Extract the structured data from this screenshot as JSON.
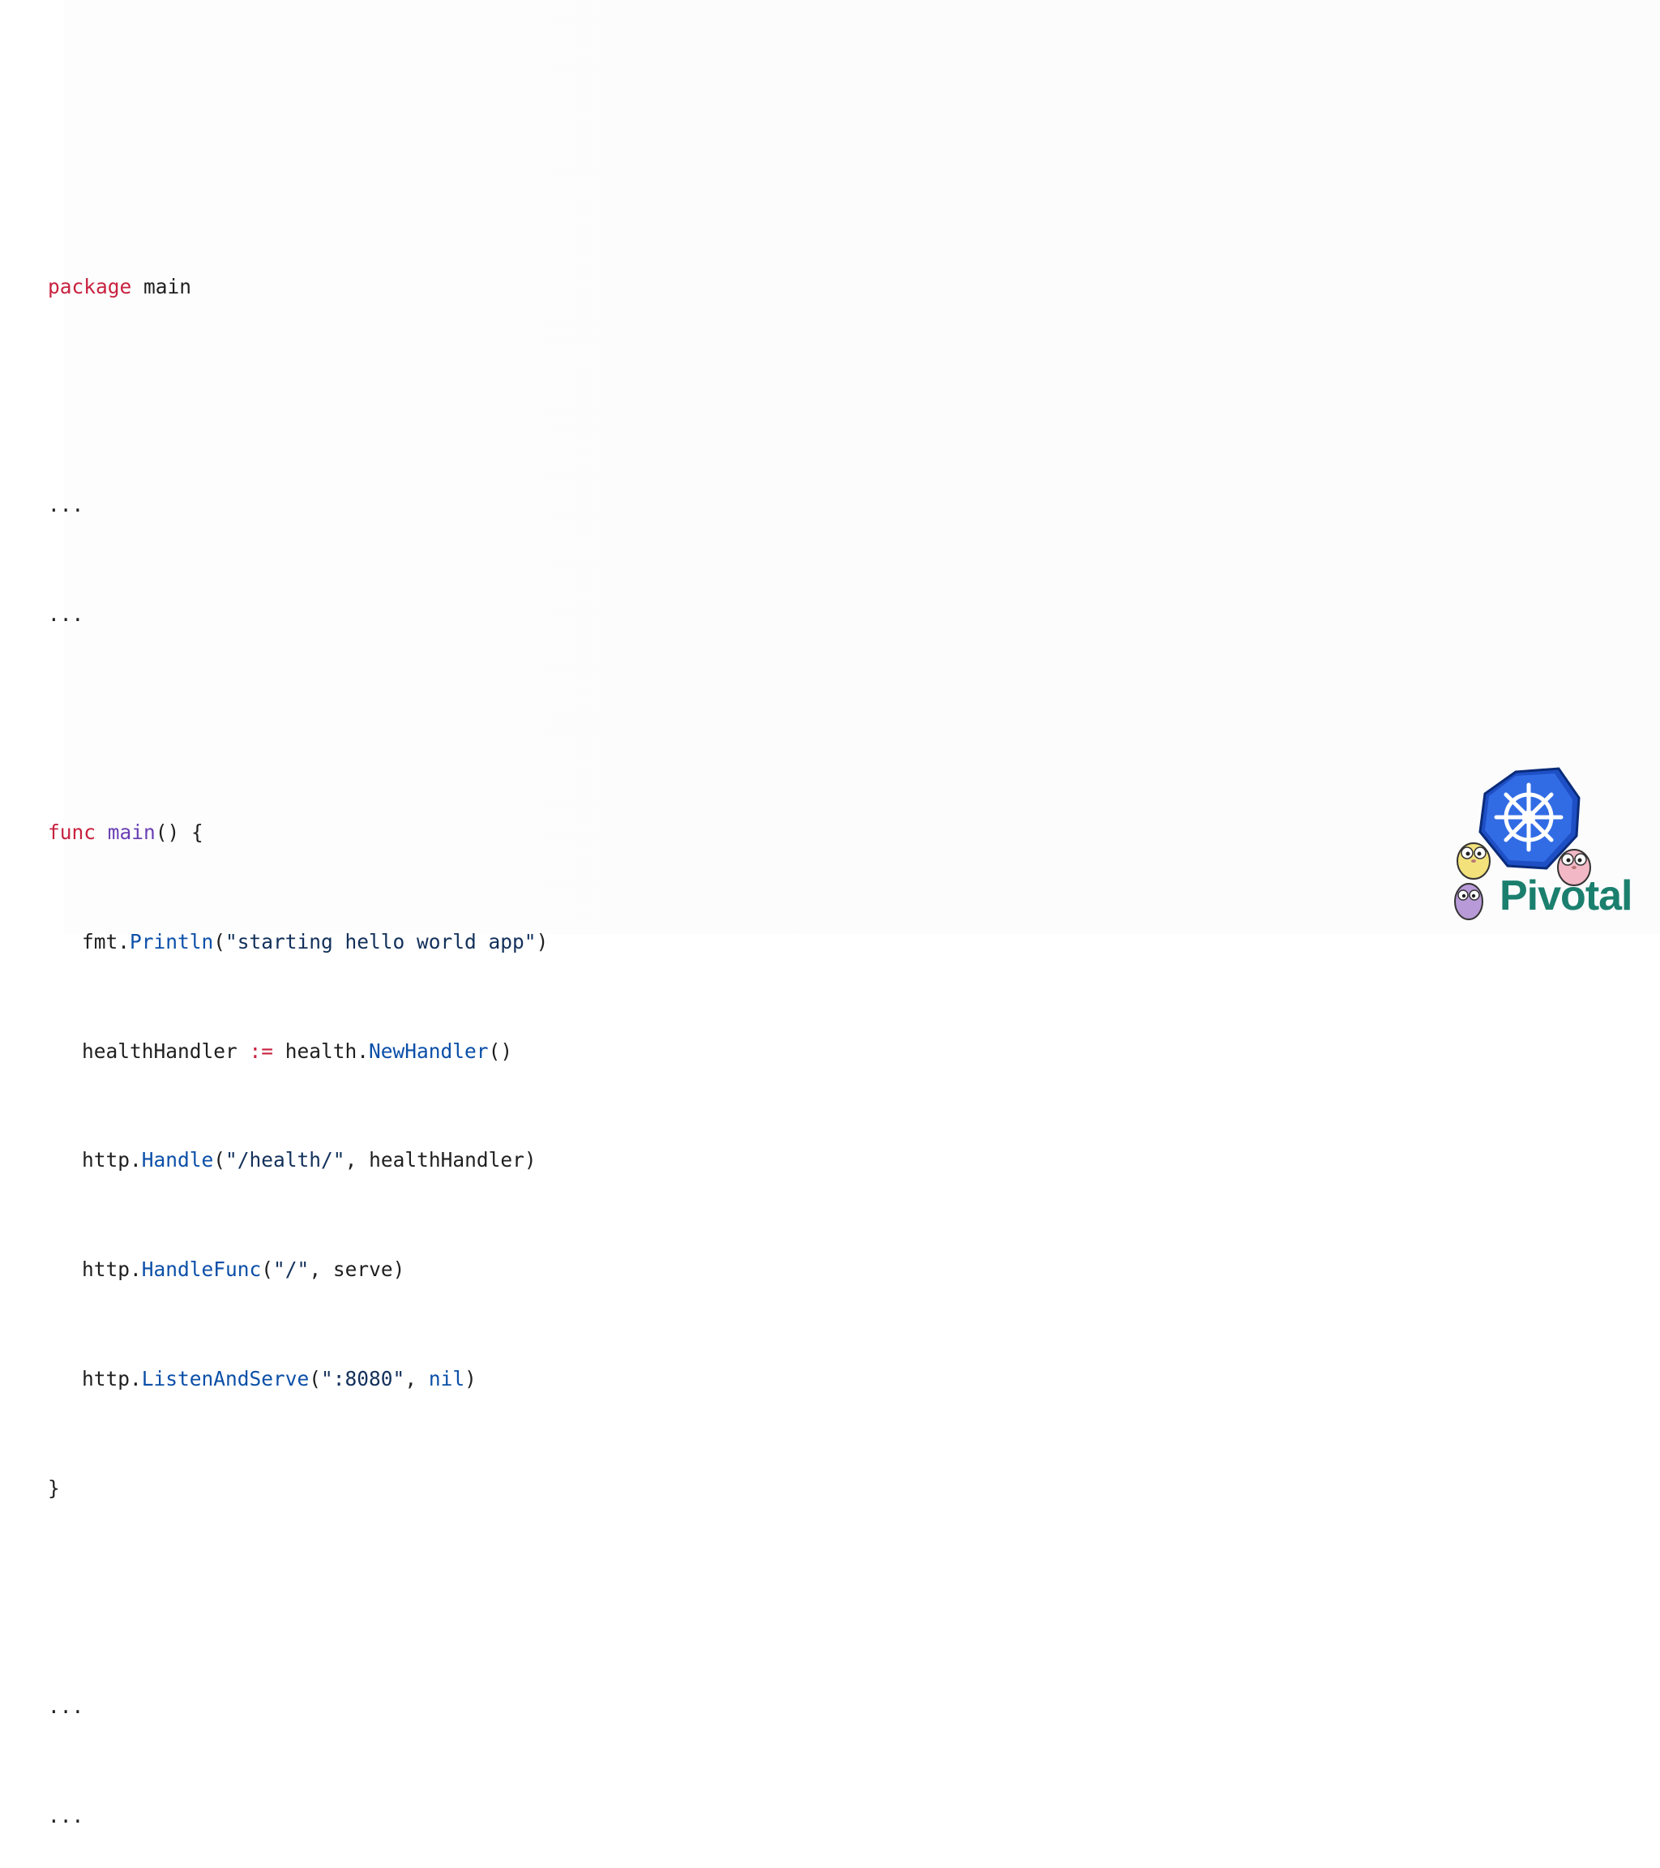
{
  "code": {
    "line1": {
      "kw": "package",
      "rest": " main"
    },
    "line3": "...",
    "line4": "...",
    "line6": {
      "kw": "func",
      "fn": "main",
      "rest": "() {"
    },
    "line7": {
      "obj": "fmt.",
      "method": "Println",
      "open": "(",
      "str": "\"starting hello world app\"",
      "close": ")"
    },
    "line8": {
      "lhs": "healthHandler ",
      "op": ":=",
      "mid": " health.",
      "method": "NewHandler",
      "rest": "()"
    },
    "line9": {
      "obj": "http.",
      "method": "Handle",
      "open": "(",
      "str": "\"/health/\"",
      "rest": ", healthHandler)"
    },
    "line10": {
      "obj": "http.",
      "method": "HandleFunc",
      "open": "(",
      "str": "\"/\"",
      "rest": ", serve)"
    },
    "line11": {
      "obj": "http.",
      "method": "ListenAndServe",
      "open": "(",
      "str": "\":8080\"",
      "sep": ", ",
      "nil": "nil",
      "close": ")"
    },
    "line12": "}",
    "line14": "...",
    "line15": "..."
  },
  "logo": {
    "brand_text": "Pivotal",
    "icons": [
      "kubernetes-helm-icon",
      "go-gopher-yellow-icon",
      "go-gopher-pink-icon",
      "go-gopher-purple-icon"
    ],
    "colors": {
      "k8s_blue": "#326ce5",
      "pivotal_teal": "#1b7f6e"
    }
  }
}
